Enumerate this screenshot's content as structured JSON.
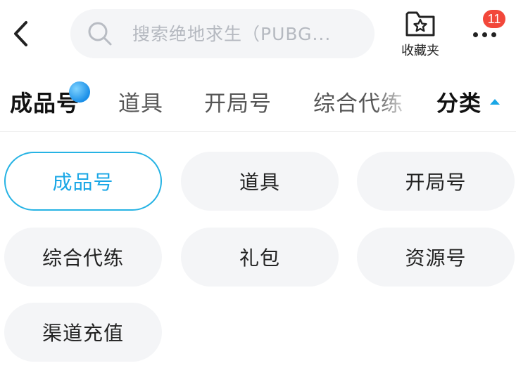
{
  "header": {
    "search": {
      "placeholder": "搜索绝地求生（PUBG..."
    },
    "favorites": {
      "label": "收藏夹",
      "icon": "star-folder-icon"
    },
    "more": {
      "icon": "more-dots-icon",
      "badge": "11"
    }
  },
  "tabs": {
    "items": [
      {
        "label": "成品号",
        "active": true
      },
      {
        "label": "道具",
        "active": false
      },
      {
        "label": "开局号",
        "active": false
      },
      {
        "label": "综合代练",
        "active": false
      }
    ],
    "category_toggle": {
      "label": "分类",
      "expanded": true
    }
  },
  "categories": {
    "items": [
      {
        "label": "成品号",
        "selected": true
      },
      {
        "label": "道具",
        "selected": false
      },
      {
        "label": "开局号",
        "selected": false
      },
      {
        "label": "综合代练",
        "selected": false
      },
      {
        "label": "礼包",
        "selected": false
      },
      {
        "label": "资源号",
        "selected": false
      },
      {
        "label": "渠道充值",
        "selected": false
      }
    ]
  },
  "colors": {
    "accent": "#1aa7e6",
    "badge": "#f2473a",
    "chip_bg": "#f4f5f7"
  }
}
